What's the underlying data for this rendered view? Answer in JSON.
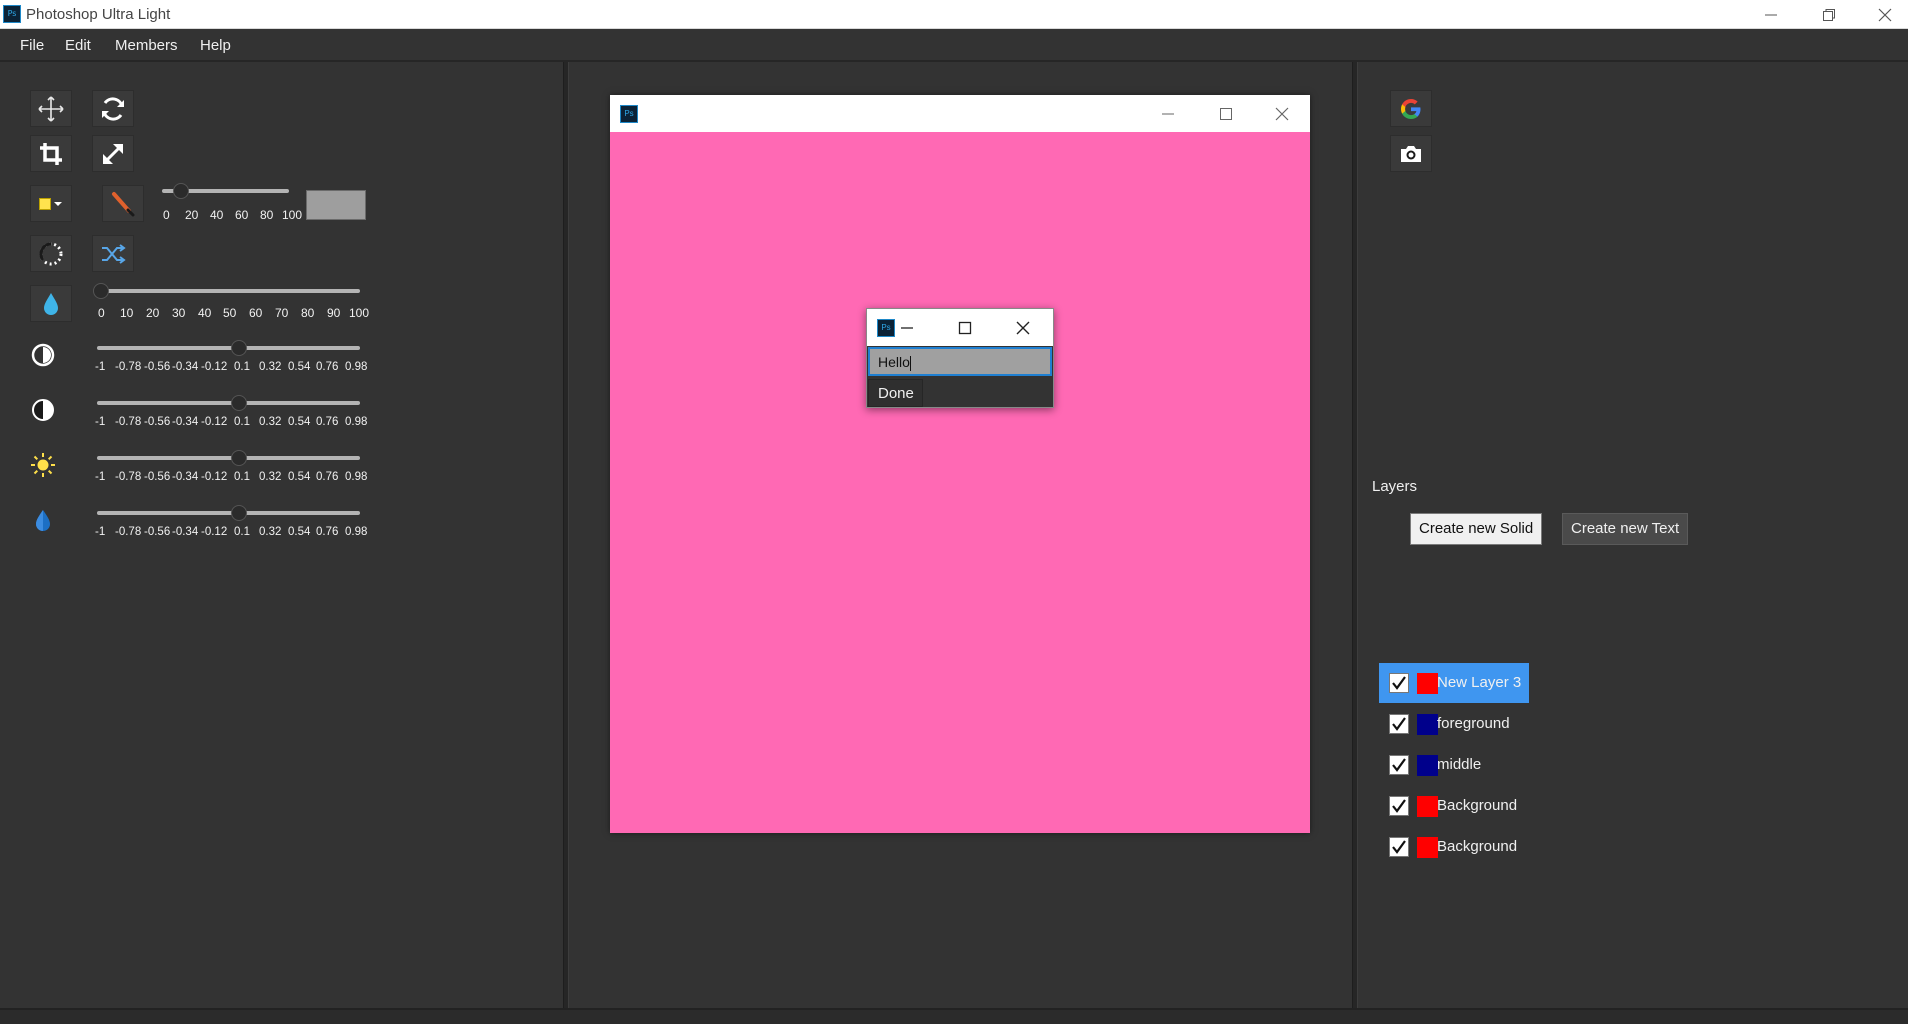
{
  "app": {
    "title": "Photoshop Ultra Light",
    "logo_text": "Ps"
  },
  "menu": [
    "File",
    "Edit",
    "Members",
    "Help"
  ],
  "brush_size": {
    "ticks": [
      "0",
      "20",
      "40",
      "60",
      "80",
      "100"
    ],
    "value": 10
  },
  "opacity": {
    "ticks": [
      "0",
      "10",
      "20",
      "30",
      "40",
      "50",
      "60",
      "70",
      "80",
      "90",
      "100"
    ],
    "value": 0
  },
  "adjustments": [
    {
      "name": "contrast",
      "icon": "contrast-icon",
      "value": 0.1,
      "ticks": [
        "-1",
        "-0.78",
        "-0.56",
        "-0.34",
        "-0.12",
        "0.1",
        "0.32",
        "0.54",
        "0.76",
        "0.98"
      ]
    },
    {
      "name": "contrast-2",
      "icon": "half-circle-icon",
      "value": 0.1,
      "ticks": [
        "-1",
        "-0.78",
        "-0.56",
        "-0.34",
        "-0.12",
        "0.1",
        "0.32",
        "0.54",
        "0.76",
        "0.98"
      ]
    },
    {
      "name": "brightness",
      "icon": "sun-icon",
      "value": 0.1,
      "ticks": [
        "-1",
        "-0.78",
        "-0.56",
        "-0.34",
        "-0.12",
        "0.1",
        "0.32",
        "0.54",
        "0.76",
        "0.98"
      ]
    },
    {
      "name": "saturation",
      "icon": "drop-icon",
      "value": 0.1,
      "ticks": [
        "-1",
        "-0.78",
        "-0.56",
        "-0.34",
        "-0.12",
        "0.1",
        "0.32",
        "0.54",
        "0.76",
        "0.98"
      ]
    }
  ],
  "colors": {
    "canvas": "#ff69b4",
    "selected_layer": "#3f96f0",
    "primary_swatch": "#ffe34d",
    "secondary_swatch": "#9e9e9e"
  },
  "dialog": {
    "input_value": "Hello",
    "done_label": "Done"
  },
  "layers": {
    "title": "Layers",
    "create_solid_label": "Create new Solid",
    "create_text_label": "Create new Text",
    "items": [
      {
        "name": "New Layer 3",
        "color": "#ff0000",
        "checked": true,
        "selected": true
      },
      {
        "name": "foreground",
        "color": "#00008b",
        "checked": true,
        "selected": false
      },
      {
        "name": "middle",
        "color": "#00008b",
        "checked": true,
        "selected": false
      },
      {
        "name": "Background",
        "color": "#ff0000",
        "checked": true,
        "selected": false
      },
      {
        "name": "Background",
        "color": "#ff0000",
        "checked": true,
        "selected": false
      }
    ]
  }
}
